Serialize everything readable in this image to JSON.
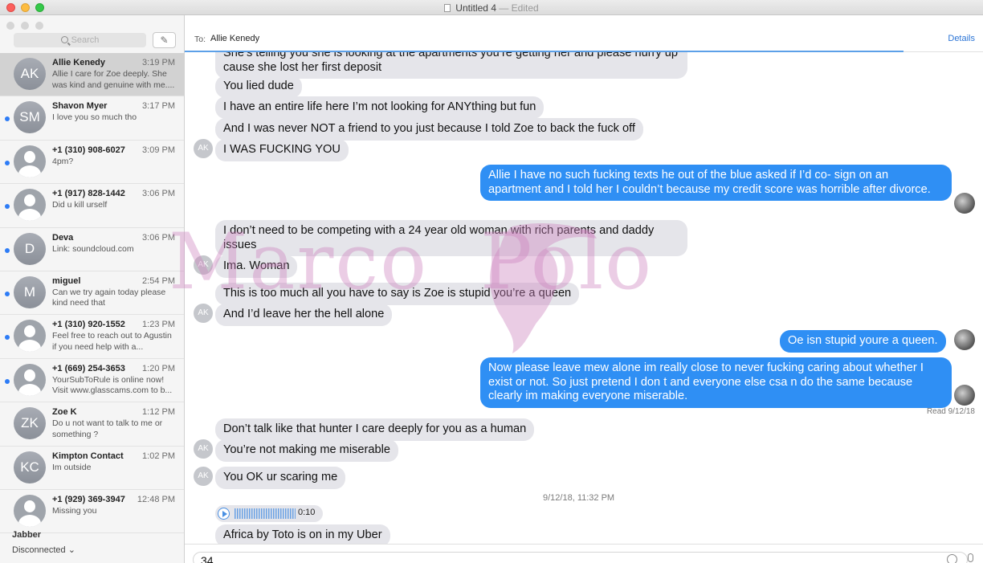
{
  "window": {
    "title": "Untitled 4",
    "edited": "— Edited"
  },
  "sidebar": {
    "search_placeholder": "Search",
    "conversations": [
      {
        "initials": "AK",
        "name": "Allie Kenedy",
        "time": "3:19 PM",
        "preview": "Allie I care for Zoe deeply. She was kind and genuine with me....",
        "selected": true,
        "unread": false
      },
      {
        "initials": "SM",
        "name": "Shavon Myer",
        "time": "3:17 PM",
        "preview": "I love you so much tho",
        "unread": true
      },
      {
        "initials": "",
        "name": "+1 (310) 908-6027",
        "time": "3:09 PM",
        "preview": "4pm?",
        "unread": true
      },
      {
        "initials": "",
        "name": "+1 (917) 828-1442",
        "time": "3:06 PM",
        "preview": "Did u kill urself",
        "unread": true
      },
      {
        "initials": "D",
        "name": "Deva",
        "time": "3:06 PM",
        "preview": "Link: soundcloud.com",
        "unread": true
      },
      {
        "initials": "M",
        "name": "miguel",
        "time": "2:54 PM",
        "preview": "Can we try again today please kind need that",
        "unread": true
      },
      {
        "initials": "",
        "name": "+1 (310) 920-1552",
        "time": "1:23 PM",
        "preview": "Feel free to reach out to Agustin if you need help with a...",
        "unread": true
      },
      {
        "initials": "",
        "name": "+1 (669) 254-3653",
        "time": "1:20 PM",
        "preview": "YourSubToRule is online now! Visit www.glasscams.com to b...",
        "unread": true
      },
      {
        "initials": "ZK",
        "name": "Zoe K",
        "time": "1:12 PM",
        "preview": "Do u not want to talk to me or something ?",
        "unread": false
      },
      {
        "initials": "KC",
        "name": "Kimpton Contact",
        "time": "1:02 PM",
        "preview": "Im outside",
        "unread": false
      },
      {
        "initials": "",
        "name": "+1 (929) 369-3947",
        "time": "12:48 PM",
        "preview": "Missing you",
        "unread": false
      }
    ],
    "jabber_label": "Jabber",
    "jabber_status": "Disconnected ⌄"
  },
  "header": {
    "to_label": "To:",
    "recipient": "Allie Kenedy",
    "details_label": "Details"
  },
  "thread": {
    "contact_initials": "AK",
    "messages": [
      {
        "from": "them",
        "text": "She’s telling you she is looking at the apartments you’re getting her and please hurry up cause she lost her first deposit"
      },
      {
        "from": "them",
        "text": "You lied dude"
      },
      {
        "from": "them",
        "text": "I have an entire life here I’m not looking for ANYthing but fun"
      },
      {
        "from": "them",
        "text": "And I was never NOT a friend to you just because I told Zoe to back the fuck off"
      },
      {
        "from": "them",
        "text": "I WAS FUCKING YOU"
      },
      {
        "from": "me",
        "text": "Allie I have no such fucking texts he out of the blue asked if I’d co- sign on an apartment and I told her I couldn’t because my credit score was horrible after divorce."
      },
      {
        "from": "them",
        "text": "I don’t need to be competing with a 24 year old woman with rich parents and daddy issues"
      },
      {
        "from": "them",
        "text": "Ima. Woman"
      },
      {
        "from": "them",
        "text": "This is too much all you have to say is Zoe is stupid you’re a queen"
      },
      {
        "from": "them",
        "text": "And I’d leave her the hell alone"
      },
      {
        "from": "me",
        "text": "Oe isn stupid youre a queen."
      },
      {
        "from": "me",
        "text": "Now please leave mew alone im really close to never fucking caring about whether I exist or not. So just pretend I don t and everyone else csa n do the same because clearly im making everyone miserable."
      },
      {
        "from": "them",
        "text": "Don’t talk like that hunter I care deeply for you as a human"
      },
      {
        "from": "them",
        "text": "You’re not making me miserable"
      },
      {
        "from": "them",
        "text": "You OK ur scaring me"
      },
      {
        "from": "them",
        "text": "Africa by Toto is on in my Uber"
      }
    ],
    "read_receipt": "Read 9/12/18",
    "timestamp": "9/12/18, 11:32 PM",
    "audio_duration": "0:10"
  },
  "input": {
    "text": "34"
  },
  "watermark": {
    "text": "Marco  Polo"
  },
  "colors": {
    "sent": "#2f8ff4",
    "received": "#e5e5ea",
    "unread_dot": "#2d7cf6",
    "watermark": "#cd82be"
  }
}
